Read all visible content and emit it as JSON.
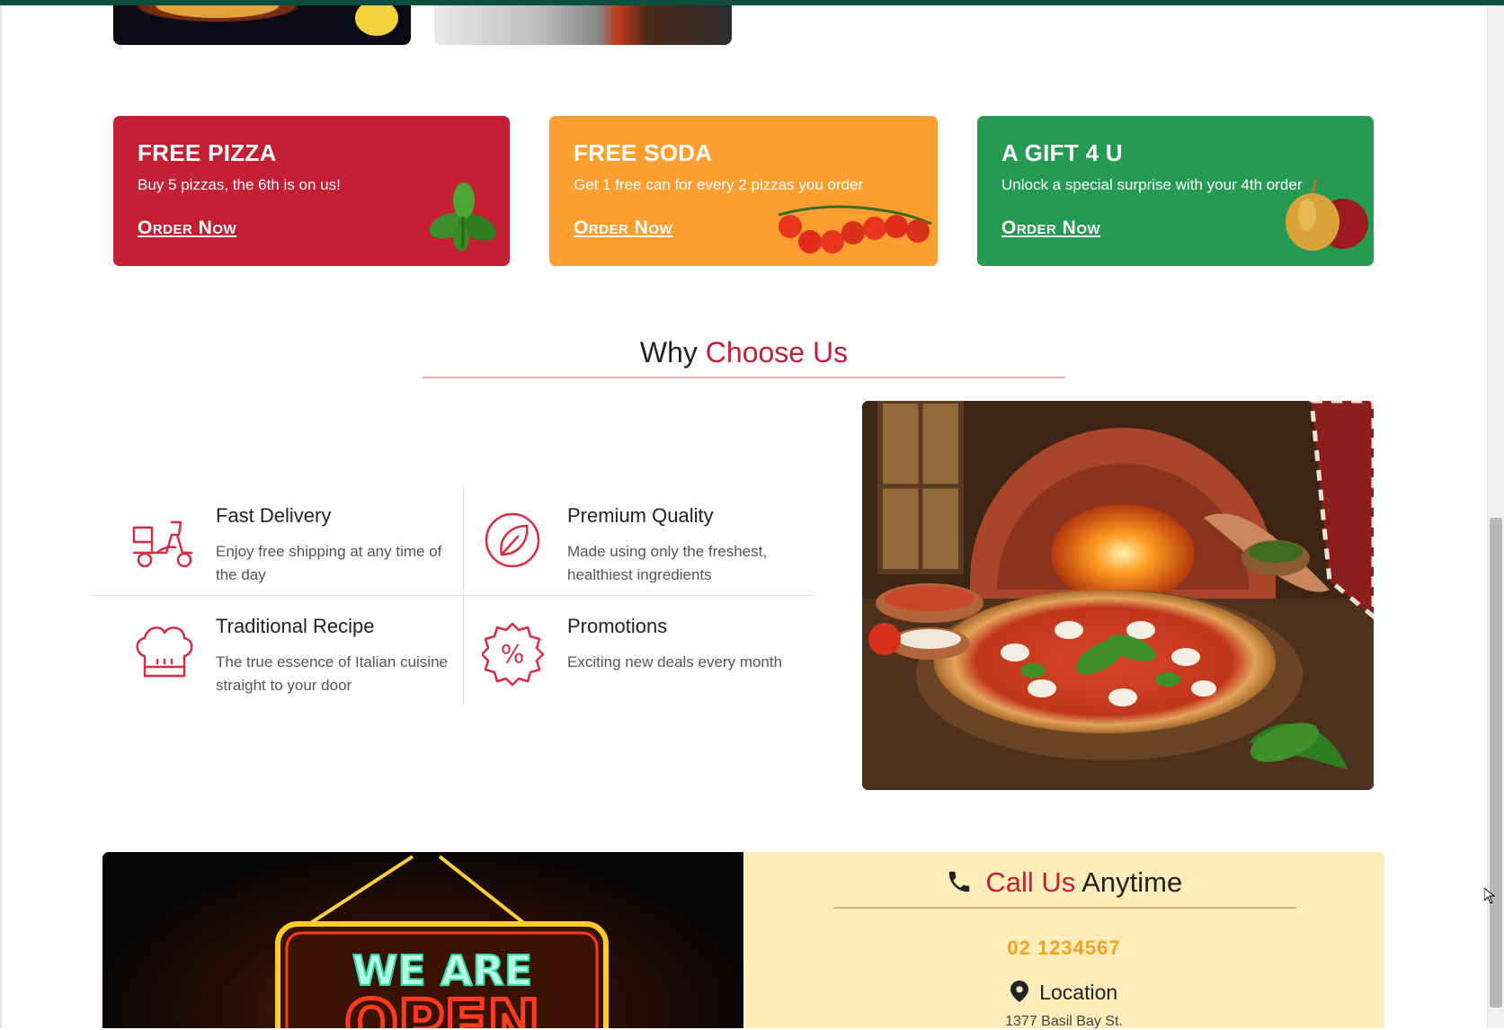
{
  "colors": {
    "brand_red": "#c41f35",
    "brand_orange": "#fd9f30",
    "brand_green": "#249a52",
    "topbar": "#0f4d3f",
    "phone_accent": "#f4a21e",
    "call_panel_bg": "#fdedba"
  },
  "promos": [
    {
      "title": "FREE PIZZA",
      "subtitle": "Buy 5 pizzas, the 6th is on us!",
      "cta": "Order Now",
      "art": "basil-leaves"
    },
    {
      "title": "FREE SODA",
      "subtitle": "Get 1 free can for every 2 pizzas you order",
      "cta": "Order Now",
      "art": "cherry-tomatoes"
    },
    {
      "title": "A GIFT 4 U",
      "subtitle": "Unlock a special surprise with your 4th order",
      "cta": "Order Now",
      "art": "onions"
    }
  ],
  "why": {
    "title_plain": "Why",
    "title_accent": "Choose Us",
    "features": [
      {
        "title": "Fast Delivery",
        "desc": "Enjoy free shipping at any time of the day",
        "icon": "scooter-icon"
      },
      {
        "title": "Premium Quality",
        "desc": "Made using only the freshest, healthiest ingredients",
        "icon": "leaf-icon"
      },
      {
        "title": "Traditional Recipe",
        "desc": "The true essence of Italian cuisine straight to your door",
        "icon": "chef-hat-icon"
      },
      {
        "title": "Promotions",
        "desc": "Exciting new deals every month",
        "icon": "percent-badge-icon"
      }
    ]
  },
  "open_sign": {
    "line1": "WE ARE",
    "line2": "OPEN"
  },
  "contact": {
    "title_accent": "Call Us",
    "title_plain": "Anytime",
    "phone": "02 1234567",
    "location_label": "Location",
    "address": "1377 Basil Bay St."
  }
}
